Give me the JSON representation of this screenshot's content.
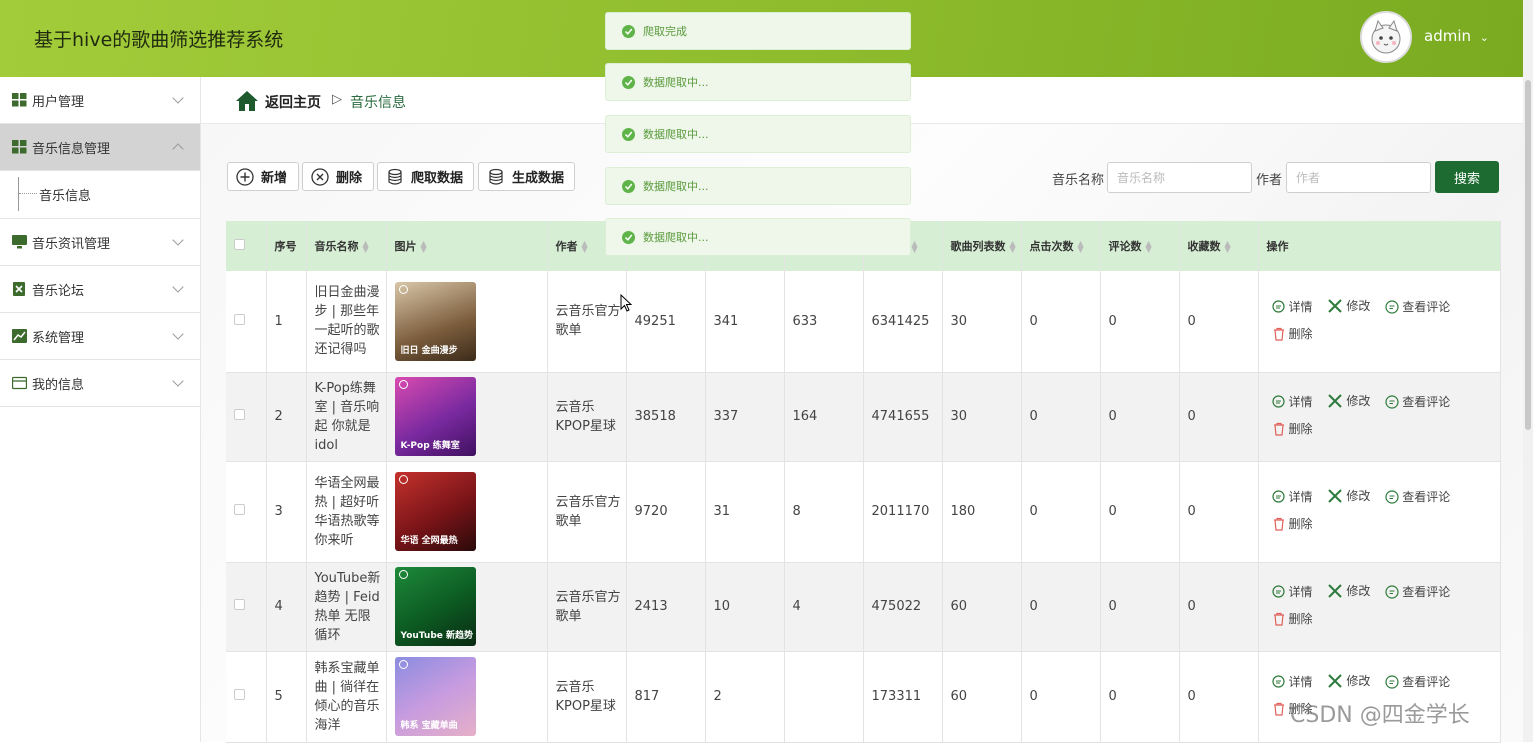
{
  "app": {
    "title": "基于hive的歌曲筛选推荐系统",
    "user": "admin"
  },
  "sidebar": {
    "items": [
      {
        "label": "用户管理"
      },
      {
        "label": "音乐信息管理"
      },
      {
        "label": "音乐资讯管理"
      },
      {
        "label": "音乐论坛"
      },
      {
        "label": "系统管理"
      },
      {
        "label": "我的信息"
      }
    ],
    "submenu": {
      "label": "音乐信息"
    }
  },
  "breadcrumb": {
    "home": "返回主页",
    "separator": "▷",
    "current": "音乐信息"
  },
  "toolbar": {
    "add": "新增",
    "delete": "删除",
    "crawl": "爬取数据",
    "generate": "生成数据"
  },
  "search": {
    "name_label": "音乐名称",
    "name_placeholder": "音乐名称",
    "author_label": "作者",
    "author_placeholder": "作者",
    "button": "搜索"
  },
  "table": {
    "headers": {
      "index": "序号",
      "name": "音乐名称",
      "image": "图片",
      "author": "作者",
      "song_count": "歌曲列表数",
      "clicks": "点击次数",
      "comments": "评论数",
      "favorites": "收藏数",
      "actions": "操作"
    },
    "actions": {
      "detail": "详情",
      "edit": "修改",
      "view_comments": "查看评论",
      "delete": "删除"
    },
    "rows": [
      {
        "index": "1",
        "name": "旧日金曲漫步 | 那些年一起听的歌 还记得吗",
        "cover_caption": "旧日 金曲漫步",
        "author": "云音乐官方歌单",
        "c1": "49251",
        "c2": "341",
        "c3": "633",
        "c4": "6341425",
        "song_count": "30",
        "clicks": "0",
        "comments": "0",
        "favorites": "0"
      },
      {
        "index": "2",
        "name": "K-Pop练舞室 | 音乐响起 你就是idol",
        "cover_caption": "K-Pop 练舞室",
        "author": "云音乐KPOP星球",
        "c1": "38518",
        "c2": "337",
        "c3": "164",
        "c4": "4741655",
        "song_count": "30",
        "clicks": "0",
        "comments": "0",
        "favorites": "0"
      },
      {
        "index": "3",
        "name": "华语全网最热 | 超好听华语热歌等你来听",
        "cover_caption": "华语 全网最热",
        "author": "云音乐官方歌单",
        "c1": "9720",
        "c2": "31",
        "c3": "8",
        "c4": "2011170",
        "song_count": "180",
        "clicks": "0",
        "comments": "0",
        "favorites": "0"
      },
      {
        "index": "4",
        "name": "YouTube新趋势 | Feid热单 无限循环",
        "cover_caption": "YouTube 新趋势",
        "author": "云音乐官方歌单",
        "c1": "2413",
        "c2": "10",
        "c3": "4",
        "c4": "475022",
        "song_count": "60",
        "clicks": "0",
        "comments": "0",
        "favorites": "0"
      },
      {
        "index": "5",
        "name": "韩系宝藏单曲 | 徜徉在倾心的音乐海洋",
        "cover_caption": "韩系 宝藏单曲",
        "author": "云音乐KPOP星球",
        "c1": "817",
        "c2": "2",
        "c3": "",
        "c4": "173311",
        "song_count": "60",
        "clicks": "0",
        "comments": "0",
        "favorites": "0"
      }
    ]
  },
  "toasts": [
    "爬取完成",
    "数据爬取中...",
    "数据爬取中...",
    "数据爬取中...",
    "数据爬取中..."
  ],
  "watermark": "CSDN @四金学长",
  "colors": {
    "header": "#8dbb2c",
    "primary_button": "#1e6b31",
    "table_header": "#d6eed3",
    "success": "#5fb449"
  }
}
